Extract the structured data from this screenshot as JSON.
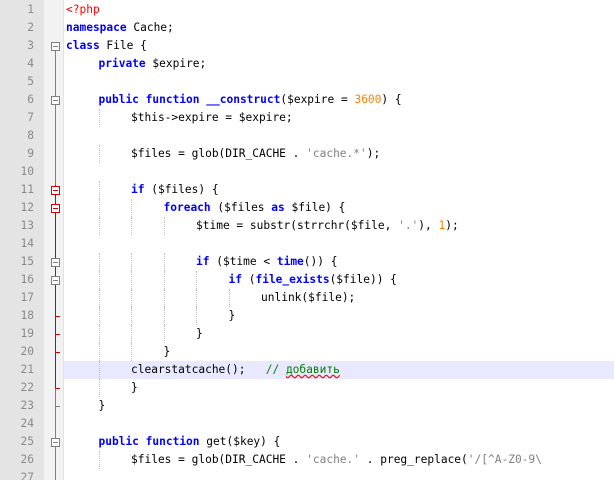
{
  "editor": {
    "current_line": 21,
    "lines": [
      {
        "n": "1",
        "indent": 0,
        "tokens": [
          [
            "tag",
            "<?php"
          ]
        ]
      },
      {
        "n": "2",
        "indent": 0,
        "tokens": [
          [
            "kw",
            "namespace"
          ],
          [
            "plain",
            " Cache;"
          ]
        ]
      },
      {
        "n": "3",
        "indent": 0,
        "tokens": [
          [
            "kw",
            "class"
          ],
          [
            "plain",
            " File {"
          ]
        ]
      },
      {
        "n": "4",
        "indent": 1,
        "tokens": [
          [
            "kw",
            "private"
          ],
          [
            "plain",
            " $expire;"
          ]
        ]
      },
      {
        "n": "5",
        "indent": 0,
        "tokens": []
      },
      {
        "n": "6",
        "indent": 1,
        "tokens": [
          [
            "kw",
            "public function __construct"
          ],
          [
            "plain",
            "($expire = "
          ],
          [
            "num",
            "3600"
          ],
          [
            "plain",
            ") {"
          ]
        ]
      },
      {
        "n": "7",
        "indent": 2,
        "tokens": [
          [
            "plain",
            "$this->expire = $expire;"
          ]
        ]
      },
      {
        "n": "8",
        "indent": 0,
        "tokens": []
      },
      {
        "n": "9",
        "indent": 2,
        "tokens": [
          [
            "plain",
            "$files = glob(DIR_CACHE . "
          ],
          [
            "str",
            "'cache.*'"
          ],
          [
            "plain",
            ");"
          ]
        ]
      },
      {
        "n": "10",
        "indent": 0,
        "tokens": []
      },
      {
        "n": "11",
        "indent": 2,
        "tokens": [
          [
            "kw",
            "if"
          ],
          [
            "plain",
            " ($files) {"
          ]
        ]
      },
      {
        "n": "12",
        "indent": 3,
        "tokens": [
          [
            "kw",
            "foreach"
          ],
          [
            "plain",
            " ($files "
          ],
          [
            "kw",
            "as"
          ],
          [
            "plain",
            " $file) {"
          ]
        ]
      },
      {
        "n": "13",
        "indent": 4,
        "tokens": [
          [
            "plain",
            "$time = substr(strrchr($file, "
          ],
          [
            "str",
            "'.'"
          ],
          [
            "plain",
            "), "
          ],
          [
            "num",
            "1"
          ],
          [
            "plain",
            ");"
          ]
        ]
      },
      {
        "n": "14",
        "indent": 0,
        "tokens": []
      },
      {
        "n": "15",
        "indent": 4,
        "tokens": [
          [
            "kw",
            "if"
          ],
          [
            "plain",
            " ($time < "
          ],
          [
            "kw",
            "time"
          ],
          [
            "plain",
            "()) {"
          ]
        ]
      },
      {
        "n": "16",
        "indent": 5,
        "tokens": [
          [
            "kw",
            "if"
          ],
          [
            "plain",
            " ("
          ],
          [
            "kw",
            "file_exists"
          ],
          [
            "plain",
            "($file)) {"
          ]
        ]
      },
      {
        "n": "17",
        "indent": 6,
        "tokens": [
          [
            "plain",
            "unlink($file);"
          ]
        ]
      },
      {
        "n": "18",
        "indent": 5,
        "tokens": [
          [
            "plain",
            "}"
          ]
        ]
      },
      {
        "n": "19",
        "indent": 4,
        "tokens": [
          [
            "plain",
            "}"
          ]
        ]
      },
      {
        "n": "20",
        "indent": 3,
        "tokens": [
          [
            "plain",
            "}"
          ]
        ]
      },
      {
        "n": "21",
        "indent": 2,
        "tokens": [
          [
            "plain",
            "clearstatcache();   "
          ],
          [
            "cmt",
            "// "
          ],
          [
            "cmtw",
            "добавить"
          ]
        ]
      },
      {
        "n": "22",
        "indent": 2,
        "tokens": [
          [
            "plain",
            "}"
          ]
        ]
      },
      {
        "n": "23",
        "indent": 1,
        "tokens": [
          [
            "plain",
            "}"
          ]
        ]
      },
      {
        "n": "24",
        "indent": 0,
        "tokens": []
      },
      {
        "n": "25",
        "indent": 1,
        "tokens": [
          [
            "kw",
            "public function"
          ],
          [
            "plain",
            " get($key) {"
          ]
        ]
      },
      {
        "n": "26",
        "indent": 2,
        "tokens": [
          [
            "plain",
            "$files = glob(DIR_CACHE . "
          ],
          [
            "str",
            "'cache.'"
          ],
          [
            "plain",
            " . preg_replace("
          ],
          [
            "str",
            "'/[^A-Z0-9\\"
          ]
        ]
      },
      {
        "n": "27",
        "indent": 0,
        "tokens": []
      }
    ],
    "folds": [
      {
        "line": 3,
        "color": "gray",
        "box": true
      },
      {
        "line": 6,
        "color": "gray",
        "box": true
      },
      {
        "line": 11,
        "color": "red",
        "box": true
      },
      {
        "line": 12,
        "color": "red",
        "box": true
      },
      {
        "line": 15,
        "color": "gray",
        "box": true
      },
      {
        "line": 16,
        "color": "gray",
        "box": true
      },
      {
        "line": 25,
        "color": "gray",
        "box": true
      }
    ]
  }
}
